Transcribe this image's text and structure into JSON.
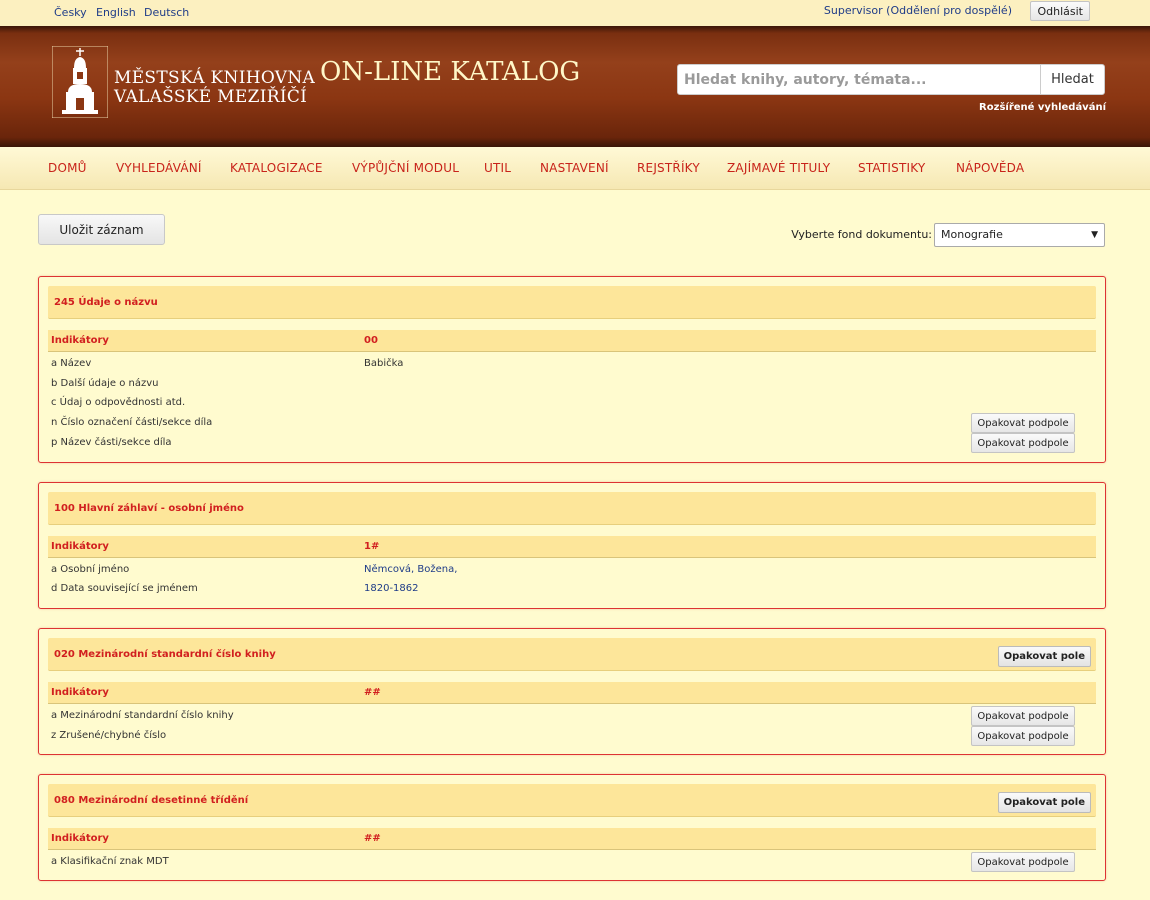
{
  "topbar": {
    "languages": [
      "Česky",
      "English",
      "Deutsch"
    ],
    "user": "Supervisor (Oddělení pro dospělé)",
    "logout_label": "Odhlásit"
  },
  "header": {
    "logo_line1": "MĚSTSKÁ KNIHOVNA",
    "logo_line2": "VALAŠSKÉ MEZIŘÍČÍ",
    "title": "ON-LINE KATALOG",
    "search_placeholder": "Hledat knihy, autory, témata...",
    "search_button": "Hledat",
    "advanced_search": "Rozšířené vyhledávání"
  },
  "nav": {
    "items": [
      "DOMŮ",
      "VYHLEDÁVÁNÍ",
      "KATALOGIZACE",
      "VÝPŮJČNÍ MODUL",
      "UTIL",
      "NASTAVENÍ",
      "REJSTŘÍKY",
      "ZAJÍMAVÉ TITULY",
      "STATISTIKY",
      "NÁPOVĚDA"
    ]
  },
  "toolbar": {
    "save_label": "Uložit záznam",
    "fond_label": "Vyberte fond dokumentu:",
    "fond_value": "Monografie"
  },
  "labels": {
    "indicators": "Indikátory",
    "repeat_subfield": "Opakovat podpole",
    "repeat_field": "Opakovat pole"
  },
  "fields": [
    {
      "title": "245 Údaje o názvu",
      "indicators": "00",
      "subfields": [
        {
          "label": "a Název",
          "value": "Babička"
        },
        {
          "label": "b Další údaje o názvu",
          "value": ""
        },
        {
          "label": "c Údaj o odpovědnosti atd.",
          "value": ""
        },
        {
          "label": "n Číslo označení části/sekce díla",
          "value": ""
        },
        {
          "label": "p Název části/sekce díla",
          "value": ""
        }
      ]
    },
    {
      "title": "100 Hlavní záhlaví - osobní jméno",
      "indicators": "1#",
      "subfields": [
        {
          "label": "a Osobní jméno",
          "value": "Němcová, Božena,"
        },
        {
          "label": "d Data související se jménem",
          "value": "1820-1862"
        }
      ]
    },
    {
      "title": "020 Mezinárodní standardní číslo knihy",
      "indicators": "##",
      "subfields": [
        {
          "label": "a Mezinárodní standardní číslo knihy",
          "value": ""
        },
        {
          "label": "z Zrušené/chybné číslo",
          "value": ""
        }
      ]
    },
    {
      "title": "080 Mezinárodní desetinné třídění",
      "indicators": "##",
      "subfields": [
        {
          "label": "a Klasifikační znak MDT",
          "value": ""
        }
      ]
    }
  ]
}
